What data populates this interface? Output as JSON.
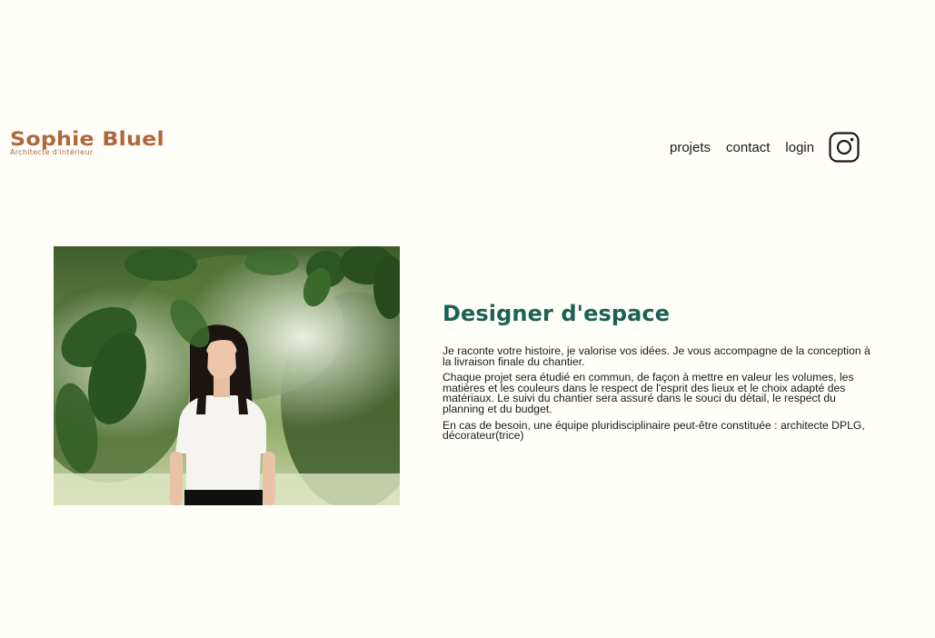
{
  "brand": {
    "name": "Sophie Bluel",
    "subtitle": "Architecte d'intérieur"
  },
  "nav": {
    "items": [
      "projets",
      "contact",
      "login"
    ],
    "instagram_icon": "instagram-icon"
  },
  "intro": {
    "title": "Designer d'espace",
    "paragraphs": [
      "Je raconte votre histoire, je valorise vos idées. Je vous accompagne de la conception à la livraison finale du chantier.",
      "Chaque projet sera étudié en commun, de façon à mettre en valeur les volumes, les matières et les couleurs dans le respect de l'esprit des lieux et le choix adapté des matériaux. Le suivi du chantier sera assuré dans le souci du détail, le respect du planning et du budget.",
      "En cas de besoin, une équipe pluridisciplinaire peut-être constituée : architecte DPLG, décorateur(trice)"
    ]
  },
  "colors": {
    "background": "#FFFEF8",
    "brand": "#B1663C",
    "accent": "#1D6154",
    "text": "#1a1a1a"
  }
}
